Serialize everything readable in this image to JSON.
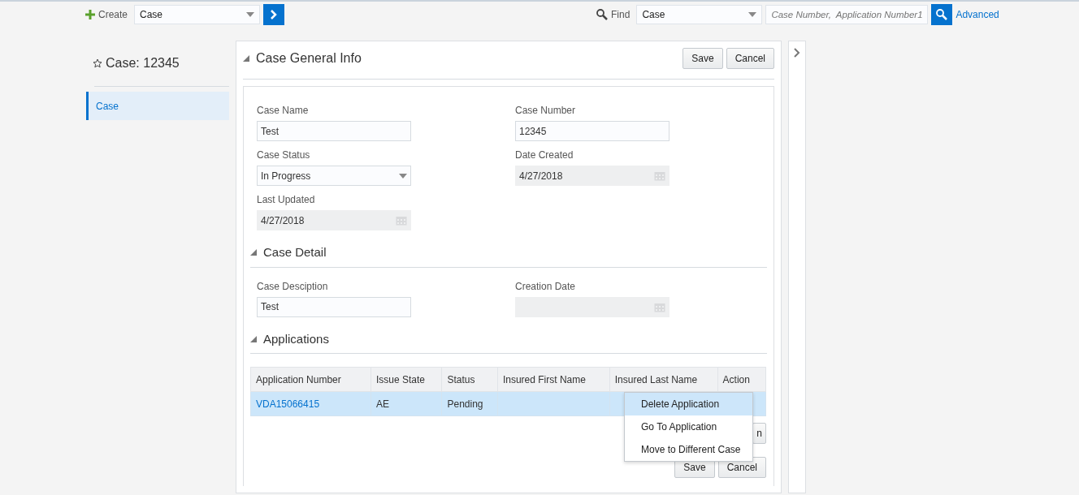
{
  "topbar": {
    "create_label": "Create",
    "create_select": "Case",
    "find_label": "Find",
    "find_select": "Case",
    "search": {
      "placeholder": "Case Number,  Application Number1"
    },
    "advanced": "Advanced"
  },
  "sidebar": {
    "title": "Case: 12345",
    "items": [
      {
        "label": "Case",
        "selected": true
      }
    ]
  },
  "header": {
    "title": "Case General Info",
    "expanded": true,
    "buttons": [
      "Save",
      "Cancel"
    ]
  },
  "sections": [
    {
      "fields": [
        {
          "label": "Case Name",
          "value": "Test",
          "kind": "text"
        },
        {
          "label": "Case Number",
          "value": "12345",
          "kind": "text"
        },
        {
          "label": "Case Status",
          "value": "In Progress",
          "kind": "select"
        },
        {
          "label": "Date Created",
          "value": "4/27/2018",
          "kind": "date"
        },
        {
          "label": "Last Updated",
          "value": "4/27/2018",
          "kind": "date"
        }
      ]
    },
    {
      "title": "Case Detail",
      "expanded": true,
      "fields": [
        {
          "label": "Case Desciption",
          "value": "Test",
          "kind": "text"
        },
        {
          "label": "Creation Date",
          "kind": "date"
        }
      ]
    },
    {
      "title": "Applications",
      "expanded": true
    }
  ],
  "table": {
    "columns": [
      "Application Number",
      "Issue State",
      "Status",
      "Insured First Name",
      "Insured Last Name",
      "Action"
    ],
    "rows": [
      {
        "selected": true,
        "cells": [
          "VDA15066415",
          "AE",
          "Pending",
          "",
          "",
          ""
        ]
      }
    ]
  },
  "partial_button": {
    "label": "n"
  },
  "context_menu": {
    "items": [
      {
        "label": "Delete Application",
        "selected": true
      },
      {
        "label": "Go To Application",
        "selected": false
      },
      {
        "label": "Move to Different Case",
        "selected": false
      }
    ]
  },
  "footer_buttons": [
    "Save",
    "Cancel"
  ]
}
